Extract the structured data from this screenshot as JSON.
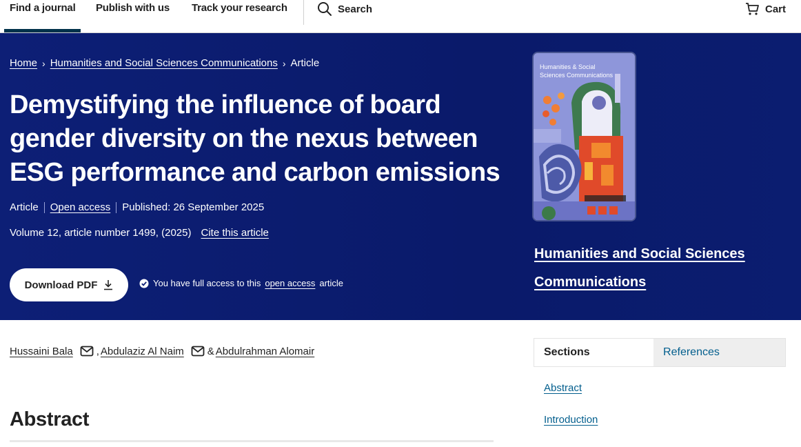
{
  "nav": {
    "items": [
      "Find a journal",
      "Publish with us",
      "Track your research"
    ],
    "search_label": "Search",
    "cart_label": "Cart"
  },
  "breadcrumb": [
    "Home",
    "Humanities and Social Sciences Communications",
    "Article"
  ],
  "article": {
    "title": "Demystifying the influence of board gender diversity on the nexus between ESG performance and carbon emissions",
    "type": "Article",
    "access": "Open access",
    "published": "Published: 26 September 2025",
    "volume_info": "Volume 12, article number 1499, (2025)",
    "cite_label": "Cite this article",
    "download_label": "Download PDF",
    "access_note_prefix": "You have full access to this",
    "access_note_link": "open access",
    "access_note_suffix": "article"
  },
  "journal": {
    "name": "Humanities and Social Sciences Communications",
    "cover_text": "Humanities & Social Sciences Communications"
  },
  "authors": {
    "names": [
      "Hussaini Bala",
      "Abdulaziz Al Naim",
      "Abdulrahman Alomair"
    ],
    "sep1": ",",
    "sep2": "&"
  },
  "abstract_heading": "Abstract",
  "sidebar": {
    "tabs": [
      "Sections",
      "References"
    ],
    "links": [
      "Abstract",
      "Introduction"
    ]
  },
  "colors": {
    "hero_bg": "#0d1f76",
    "link": "#025e8d",
    "nav_active": "#01324b"
  }
}
